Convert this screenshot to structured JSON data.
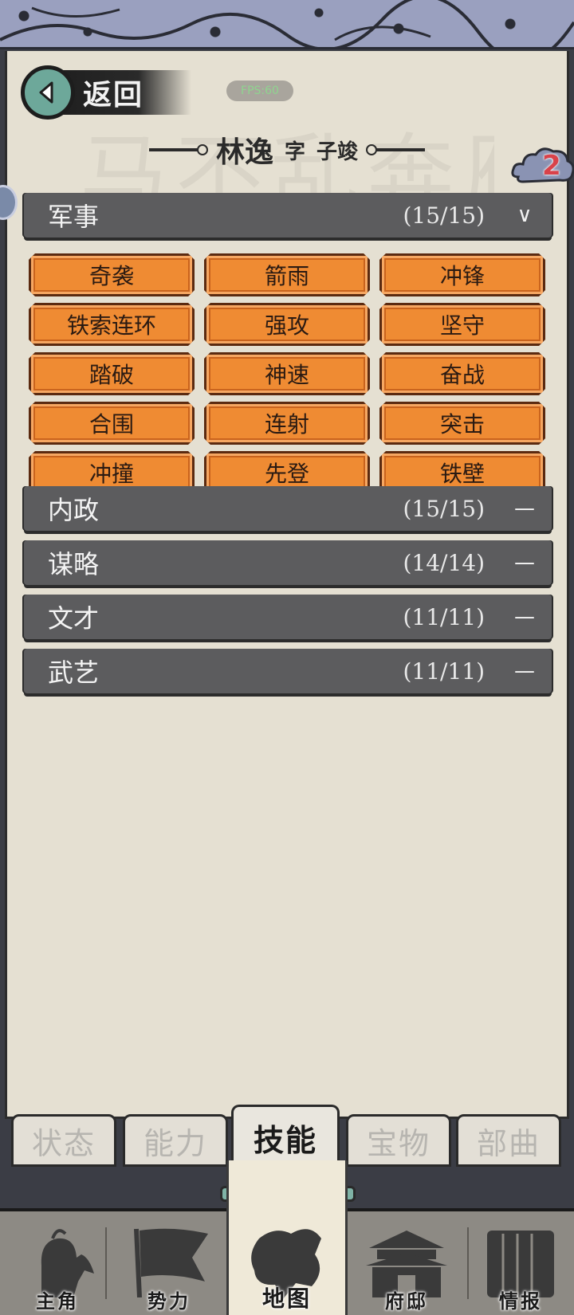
{
  "header": {
    "back_label": "返回",
    "fps_label": "FPS:60",
    "name": "林逸",
    "style_label": "字",
    "courtesy_name": "子竣",
    "badge_count": "2",
    "watermark_text": "马不乱奔雁"
  },
  "categories": [
    {
      "name": "军事",
      "count": "(15/15)",
      "toggle": "∨"
    },
    {
      "name": "内政",
      "count": "(15/15)",
      "toggle": "—"
    },
    {
      "name": "谋略",
      "count": "(14/14)",
      "toggle": "—"
    },
    {
      "name": "文才",
      "count": "(11/11)",
      "toggle": "—"
    },
    {
      "name": "武艺",
      "count": "(11/11)",
      "toggle": "—"
    }
  ],
  "military_skills": [
    "奇袭",
    "箭雨",
    "冲锋",
    "铁索连环",
    "强攻",
    "坚守",
    "踏破",
    "神速",
    "奋战",
    "合围",
    "连射",
    "突击",
    "冲撞",
    "先登",
    "铁壁"
  ],
  "tabs": [
    {
      "label": "状态",
      "active": false
    },
    {
      "label": "能力",
      "active": false
    },
    {
      "label": "技能",
      "active": true
    },
    {
      "label": "宝物",
      "active": false
    },
    {
      "label": "部曲",
      "active": false
    }
  ],
  "nav": [
    {
      "label": "主角",
      "icon": "warrior-icon"
    },
    {
      "label": "势力",
      "icon": "flag-icon"
    },
    {
      "label": "地图",
      "icon": "map-icon"
    },
    {
      "label": "府邸",
      "icon": "mansion-icon"
    },
    {
      "label": "情报",
      "icon": "scroll-icon"
    }
  ],
  "colors": {
    "skill_orange": "#ef8b33",
    "category_bar": "#5c5c5e",
    "paper": "#e5e0d2",
    "back_circle": "#6da89a",
    "badge_red": "#d9424a"
  }
}
